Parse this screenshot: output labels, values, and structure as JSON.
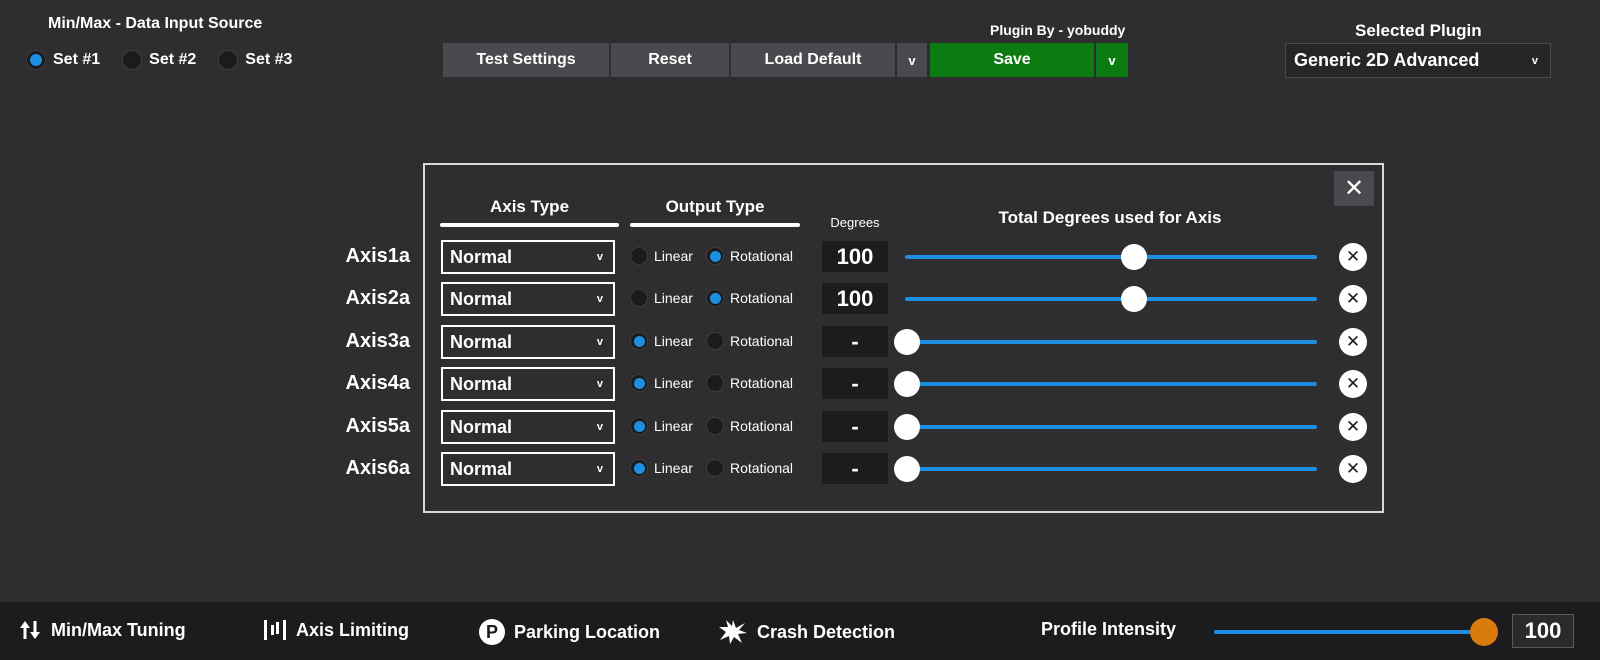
{
  "data_source": {
    "title": "Min/Max - Data Input Source",
    "sets": [
      {
        "label": "Set #1",
        "selected": true
      },
      {
        "label": "Set #2",
        "selected": false
      },
      {
        "label": "Set #3",
        "selected": false
      }
    ]
  },
  "toolbar": {
    "test_label": "Test Settings",
    "reset_label": "Reset",
    "load_label": "Load Default",
    "load_caret": "v",
    "save_label": "Save",
    "save_caret": "v",
    "plugin_by": "Plugin By - yobuddy"
  },
  "plugin_select": {
    "title": "Selected Plugin",
    "value": "Generic 2D Advanced",
    "caret": "v"
  },
  "dialog": {
    "close_glyph": "✕",
    "headers": {
      "axis_type": "Axis Type",
      "output_type": "Output Type",
      "degrees": "Degrees",
      "total": "Total Degrees used for Axis"
    },
    "option_linear": "Linear",
    "option_rotational": "Rotational",
    "axes": [
      {
        "label": "Axis1a",
        "type": "Normal",
        "caret": "v",
        "output": "Rotational",
        "degrees": "100",
        "slider": 0.55
      },
      {
        "label": "Axis2a",
        "type": "Normal",
        "caret": "v",
        "output": "Rotational",
        "degrees": "100",
        "slider": 0.55
      },
      {
        "label": "Axis3a",
        "type": "Normal",
        "caret": "v",
        "output": "Linear",
        "degrees": "-",
        "slider": 0.0
      },
      {
        "label": "Axis4a",
        "type": "Normal",
        "caret": "v",
        "output": "Linear",
        "degrees": "-",
        "slider": 0.0
      },
      {
        "label": "Axis5a",
        "type": "Normal",
        "caret": "v",
        "output": "Linear",
        "degrees": "-",
        "slider": 0.0
      },
      {
        "label": "Axis6a",
        "type": "Normal",
        "caret": "v",
        "output": "Linear",
        "degrees": "-",
        "slider": 0.0
      }
    ]
  },
  "bottom_bar": {
    "items": [
      {
        "label": "Min/Max Tuning",
        "icon": "up-down-arrows-icon"
      },
      {
        "label": "Axis Limiting",
        "icon": "axis-limit-bars-icon"
      },
      {
        "label": "Parking Location",
        "icon": "parking-p-icon"
      },
      {
        "label": "Crash Detection",
        "icon": "crash-burst-icon"
      }
    ],
    "intensity_label": "Profile Intensity",
    "intensity_value": "100",
    "intensity_level": 1.0
  },
  "colors": {
    "background": "#2e2e31",
    "accent_blue": "#1d8fe0",
    "save_green": "#0c7b11",
    "intensity_orange": "#d97a0f"
  }
}
